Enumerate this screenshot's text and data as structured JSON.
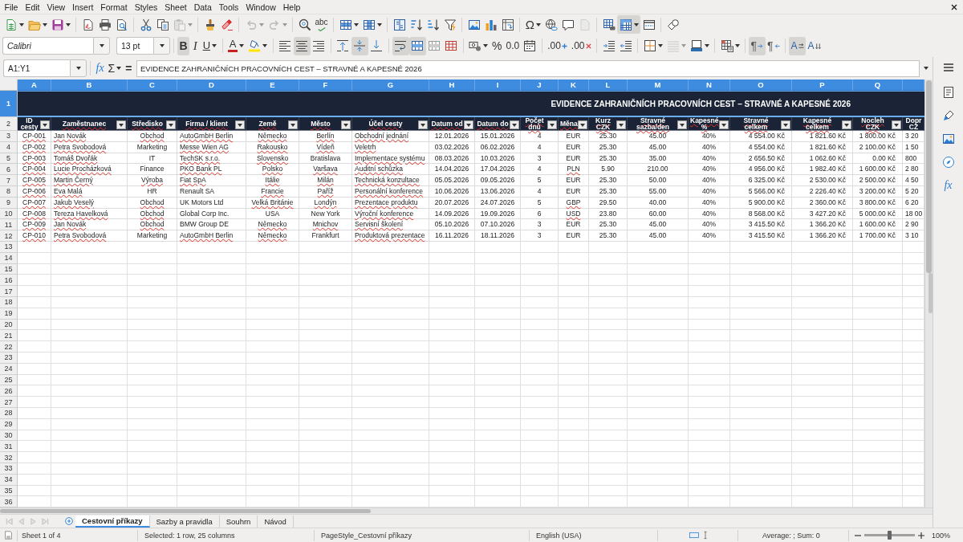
{
  "menu_bar": {
    "items": [
      "File",
      "Edit",
      "View",
      "Insert",
      "Format",
      "Styles",
      "Sheet",
      "Data",
      "Tools",
      "Window",
      "Help"
    ]
  },
  "toolbars": [
    {
      "groups": [
        [
          {
            "kind": "new",
            "dropdown": true,
            "pressed": false,
            "disabled": false
          },
          {
            "kind": "open",
            "dropdown": true,
            "pressed": false,
            "disabled": false
          },
          {
            "kind": "save",
            "dropdown": true,
            "pressed": false,
            "disabled": false
          }
        ],
        [
          {
            "kind": "pdf",
            "pressed": false,
            "disabled": false
          },
          {
            "kind": "print",
            "pressed": false,
            "disabled": false
          },
          {
            "kind": "preview",
            "pressed": false,
            "disabled": false
          }
        ],
        [
          {
            "kind": "cut",
            "pressed": false,
            "disabled": false
          },
          {
            "kind": "copy",
            "pressed": false,
            "disabled": false
          },
          {
            "kind": "paste",
            "dropdown": true,
            "pressed": false,
            "disabled": true
          }
        ],
        [
          {
            "kind": "clone",
            "pressed": false,
            "disabled": false
          },
          {
            "kind": "clear",
            "pressed": false,
            "disabled": false
          }
        ],
        [
          {
            "kind": "undo",
            "dropdown": true,
            "pressed": false,
            "disabled": true
          },
          {
            "kind": "redo",
            "dropdown": true,
            "pressed": false,
            "disabled": true
          }
        ],
        [
          {
            "kind": "find",
            "pressed": false,
            "disabled": false
          },
          {
            "kind": "spelling",
            "label": "abc",
            "pressed": false,
            "disabled": false
          }
        ],
        [
          {
            "kind": "rows",
            "dropdown": true,
            "pressed": false,
            "disabled": false
          },
          {
            "kind": "columns",
            "dropdown": true,
            "pressed": false,
            "disabled": false
          }
        ],
        [
          {
            "kind": "sort",
            "pressed": false,
            "disabled": false
          },
          {
            "kind": "ascending",
            "pressed": false,
            "disabled": false
          },
          {
            "kind": "descending",
            "pressed": false,
            "disabled": false
          },
          {
            "kind": "filter",
            "pressed": false,
            "disabled": false
          }
        ],
        [
          {
            "kind": "image",
            "pressed": false,
            "disabled": false
          },
          {
            "kind": "chart",
            "pressed": false,
            "disabled": false
          },
          {
            "kind": "pivot",
            "pressed": false,
            "disabled": false
          }
        ],
        [
          {
            "kind": "symbol",
            "label": "Ω",
            "dropdown": true,
            "pressed": false,
            "disabled": false
          },
          {
            "kind": "hyperlink",
            "pressed": false,
            "disabled": false
          },
          {
            "kind": "comment",
            "pressed": false,
            "disabled": false
          },
          {
            "kind": "headerfooter",
            "pressed": false,
            "disabled": true
          }
        ],
        [
          {
            "kind": "printarea",
            "pressed": false,
            "disabled": false
          },
          {
            "kind": "freeze",
            "dropdown": true,
            "pressed": true,
            "disabled": false
          },
          {
            "kind": "split",
            "pressed": false,
            "disabled": false
          }
        ],
        [
          {
            "kind": "shapes",
            "pressed": false,
            "disabled": false
          }
        ]
      ]
    },
    {
      "font_name": {
        "value": "Calibri"
      },
      "font_size": {
        "value": "13 pt"
      },
      "groups": [
        [
          {
            "kind": "bold",
            "label": "B",
            "pressed": true,
            "disabled": false
          },
          {
            "kind": "italic",
            "label": "I",
            "pressed": false,
            "disabled": false
          },
          {
            "kind": "underline",
            "label": "U",
            "dropdown": true,
            "pressed": false,
            "disabled": false
          }
        ],
        [
          {
            "kind": "fontcolor",
            "label": "A",
            "dropdown": true,
            "pressed": false,
            "disabled": false
          },
          {
            "kind": "highlight",
            "dropdown": true,
            "pressed": false,
            "disabled": false
          }
        ],
        [
          {
            "kind": "left",
            "pressed": false,
            "disabled": false
          },
          {
            "kind": "center",
            "pressed": true,
            "disabled": false
          },
          {
            "kind": "right",
            "pressed": false,
            "disabled": false
          }
        ],
        [
          {
            "kind": "top",
            "pressed": false,
            "disabled": false
          },
          {
            "kind": "middle",
            "pressed": true,
            "disabled": false
          },
          {
            "kind": "bottom",
            "pressed": false,
            "disabled": false
          }
        ],
        [
          {
            "kind": "wrap",
            "pressed": true,
            "disabled": false
          },
          {
            "kind": "mergecenter",
            "pressed": true,
            "disabled": false
          },
          {
            "kind": "merge",
            "pressed": false,
            "disabled": false
          },
          {
            "kind": "unmerge",
            "pressed": false,
            "disabled": false
          }
        ],
        [
          {
            "kind": "currency",
            "dropdown": true,
            "pressed": false,
            "disabled": false
          },
          {
            "kind": "percent",
            "label": "%",
            "pressed": false,
            "disabled": false
          },
          {
            "kind": "number",
            "label": "0.0",
            "pressed": false,
            "disabled": false
          },
          {
            "kind": "date",
            "pressed": false,
            "disabled": false
          }
        ],
        [
          {
            "kind": "adddecimal",
            "label": ".00",
            "pressed": false,
            "disabled": false
          },
          {
            "kind": "deldecimal",
            "label": ".00",
            "pressed": false,
            "disabled": false
          }
        ],
        [
          {
            "kind": "indent",
            "pressed": false,
            "disabled": false
          },
          {
            "kind": "outdent",
            "pressed": false,
            "disabled": false
          }
        ],
        [
          {
            "kind": "borders",
            "dropdown": true,
            "pressed": false,
            "disabled": false
          },
          {
            "kind": "borderstyle",
            "dropdown": true,
            "pressed": false,
            "disabled": true
          },
          {
            "kind": "bordercolor",
            "dropdown": true,
            "pressed": false,
            "disabled": false
          }
        ],
        [
          {
            "kind": "conditional",
            "dropdown": true,
            "pressed": false,
            "disabled": false
          }
        ],
        [
          {
            "kind": "ltr",
            "label": "¶",
            "pressed": true,
            "disabled": false
          },
          {
            "kind": "rtl",
            "label": "¶",
            "pressed": false,
            "disabled": false
          }
        ],
        [
          {
            "kind": "textdirection",
            "label": "A",
            "pressed": true,
            "disabled": false
          },
          {
            "kind": "vertical",
            "label": "A",
            "pressed": false,
            "disabled": false
          }
        ]
      ]
    }
  ],
  "formula_bar": {
    "name_box": {
      "value": "A1:Y1"
    },
    "buttons": [
      {
        "kind": "wizard",
        "label": "fx"
      },
      {
        "kind": "sum",
        "label": "Σ",
        "dropdown": true
      },
      {
        "kind": "formula",
        "label": "="
      }
    ],
    "formula": {
      "value": "EVIDENCE ZAHRANIČNÍCH PRACOVNÍCH CEST – STRAVNÉ A KAPESNÉ 2026"
    }
  },
  "sheet": {
    "columns": [
      {
        "letter": "A",
        "selected": true
      },
      {
        "letter": "B",
        "selected": true
      },
      {
        "letter": "C",
        "selected": true
      },
      {
        "letter": "D",
        "selected": true
      },
      {
        "letter": "E",
        "selected": true
      },
      {
        "letter": "F",
        "selected": true
      },
      {
        "letter": "G",
        "selected": true
      },
      {
        "letter": "H",
        "selected": true
      },
      {
        "letter": "I",
        "selected": true
      },
      {
        "letter": "J",
        "selected": true
      },
      {
        "letter": "K",
        "selected": true
      },
      {
        "letter": "L",
        "selected": true
      },
      {
        "letter": "M",
        "selected": true
      },
      {
        "letter": "N",
        "selected": true
      },
      {
        "letter": "O",
        "selected": true
      },
      {
        "letter": "P",
        "selected": true
      },
      {
        "letter": "Q",
        "selected": true
      },
      {
        "selected": true
      }
    ],
    "title_row": {
      "number": "1",
      "selected": true,
      "title": "EVIDENCE ZAHRANIČNÍCH PRACOVNÍCH CEST – STRAVNÉ A KAPESNÉ 2026"
    },
    "header_row": {
      "number": "2",
      "selected": false,
      "headers": [
        {
          "label": "ID cesty",
          "misspelled": false,
          "filter_button": true
        },
        {
          "label": "Zaměstnanec",
          "misspelled": true,
          "filter_button": true
        },
        {
          "label": "Středisko",
          "misspelled": true,
          "filter_button": true
        },
        {
          "label": "Firma / klient",
          "misspelled": true,
          "filter_button": true
        },
        {
          "label": "Země",
          "misspelled": true,
          "filter_button": true
        },
        {
          "label": "Město",
          "misspelled": true,
          "filter_button": true
        },
        {
          "label": "Účel cesty",
          "misspelled": true,
          "filter_button": true
        },
        {
          "label": "Datum od",
          "misspelled": true,
          "filter_button": true
        },
        {
          "label": "Datum do",
          "misspelled": true,
          "filter_button": true
        },
        {
          "label": "Počet dnů",
          "misspelled": true,
          "filter_button": true
        },
        {
          "label": "Měna",
          "misspelled": true,
          "filter_button": true
        },
        {
          "label": "Kurz CZK",
          "misspelled": true,
          "filter_button": true
        },
        {
          "label": "Stravné sazba/den",
          "misspelled": true,
          "filter_button": true
        },
        {
          "label": "Kapesné %",
          "misspelled": true,
          "filter_button": true
        },
        {
          "label": "Stravné celkem",
          "misspelled": true,
          "filter_button": true
        },
        {
          "label": "Kapesné celkem",
          "misspelled": true,
          "filter_button": true
        },
        {
          "label": "Nocleh CZK",
          "misspelled": true,
          "filter_button": true
        },
        {
          "label": "Dopr CZ",
          "misspelled": false
        }
      ]
    },
    "rows": [
      {
        "number": "3",
        "selected": false,
        "cells": [
          "CP-001",
          "Jan Novák",
          "Obchod",
          "AutoGmbH Berlin",
          "Německo",
          "Berlín",
          "Obchodní jednání",
          "12.01.2026",
          "15.01.2026",
          "4",
          "EUR",
          "25.30",
          "45.00",
          "40%",
          "4 554.00 Kč",
          "1 821.60 Kč",
          "1 800.00 Kč",
          "3 20"
        ],
        "misspelled": [
          true,
          true,
          true,
          true,
          true,
          true,
          true,
          false,
          false,
          false,
          false,
          false,
          false,
          false,
          false,
          false,
          false,
          false
        ]
      },
      {
        "number": "4",
        "selected": false,
        "cells": [
          "CP-002",
          "Petra Svobodová",
          "Marketing",
          "Messe Wien AG",
          "Rakousko",
          "Vídeň",
          "Veletrh",
          "03.02.2026",
          "06.02.2026",
          "4",
          "EUR",
          "25.30",
          "45.00",
          "40%",
          "4 554.00 Kč",
          "1 821.60 Kč",
          "2 100.00 Kč",
          "1 50"
        ],
        "misspelled": [
          true,
          true,
          false,
          true,
          true,
          true,
          true,
          false,
          false,
          false,
          false,
          false,
          false,
          false,
          false,
          false,
          false,
          false
        ]
      },
      {
        "number": "5",
        "selected": false,
        "cells": [
          "CP-003",
          "Tomáš Dvořák",
          "IT",
          "TechSK s.r.o.",
          "Slovensko",
          "Bratislava",
          "Implementace systému",
          "08.03.2026",
          "10.03.2026",
          "3",
          "EUR",
          "25.30",
          "35.00",
          "40%",
          "2 656.50 Kč",
          "1 062.60 Kč",
          "0.00 Kč",
          "800"
        ],
        "misspelled": [
          true,
          true,
          false,
          true,
          true,
          false,
          true,
          false,
          false,
          false,
          false,
          false,
          false,
          false,
          false,
          false,
          false,
          false
        ]
      },
      {
        "number": "6",
        "selected": false,
        "cells": [
          "CP-004",
          "Lucie Procházková",
          "Finance",
          "PKO Bank PL",
          "Polsko",
          "Varšava",
          "Auditní schůzka",
          "14.04.2026",
          "17.04.2026",
          "4",
          "PLN",
          "5.90",
          "210.00",
          "40%",
          "4 956.00 Kč",
          "1 982.40 Kč",
          "1 600.00 Kč",
          "2 80"
        ],
        "misspelled": [
          true,
          true,
          false,
          true,
          true,
          true,
          true,
          false,
          false,
          false,
          true,
          false,
          false,
          false,
          false,
          false,
          false,
          false
        ]
      },
      {
        "number": "7",
        "selected": false,
        "cells": [
          "CP-005",
          "Martin Černý",
          "Výroba",
          "Fiat SpA",
          "Itálie",
          "Milán",
          "Technická konzultace",
          "05.05.2026",
          "09.05.2026",
          "5",
          "EUR",
          "25.30",
          "50.00",
          "40%",
          "6 325.00 Kč",
          "2 530.00 Kč",
          "2 500.00 Kč",
          "4 50"
        ],
        "misspelled": [
          true,
          true,
          true,
          true,
          true,
          true,
          true,
          false,
          false,
          false,
          false,
          false,
          false,
          false,
          false,
          false,
          false,
          false
        ]
      },
      {
        "number": "8",
        "selected": false,
        "cells": [
          "CP-006",
          "Eva Malá",
          "HR",
          "Renault SA",
          "Francie",
          "Paříž",
          "Personální konference",
          "10.06.2026",
          "13.06.2026",
          "4",
          "EUR",
          "25.30",
          "55.00",
          "40%",
          "5 566.00 Kč",
          "2 226.40 Kč",
          "3 200.00 Kč",
          "5 20"
        ],
        "misspelled": [
          true,
          true,
          false,
          false,
          true,
          true,
          true,
          false,
          false,
          false,
          false,
          false,
          false,
          false,
          false,
          false,
          false,
          false
        ]
      },
      {
        "number": "9",
        "selected": false,
        "cells": [
          "CP-007",
          "Jakub Veselý",
          "Obchod",
          "UK Motors Ltd",
          "Velká Británie",
          "Londýn",
          "Prezentace produktu",
          "20.07.2026",
          "24.07.2026",
          "5",
          "GBP",
          "29.50",
          "40.00",
          "40%",
          "5 900.00 Kč",
          "2 360.00 Kč",
          "3 800.00 Kč",
          "6 20"
        ],
        "misspelled": [
          true,
          true,
          true,
          false,
          true,
          true,
          true,
          false,
          false,
          false,
          true,
          false,
          false,
          false,
          false,
          false,
          false,
          false
        ]
      },
      {
        "number": "10",
        "selected": false,
        "cells": [
          "CP-008",
          "Tereza Havelková",
          "Obchod",
          "Global Corp Inc.",
          "USA",
          "New York",
          "Výroční konference",
          "14.09.2026",
          "19.09.2026",
          "6",
          "USD",
          "23.80",
          "60.00",
          "40%",
          "8 568.00 Kč",
          "3 427.20 Kč",
          "5 000.00 Kč",
          "18 00"
        ],
        "misspelled": [
          true,
          true,
          true,
          false,
          false,
          false,
          true,
          false,
          false,
          false,
          true,
          false,
          false,
          false,
          false,
          false,
          false,
          false
        ]
      },
      {
        "number": "11",
        "selected": false,
        "cells": [
          "CP-009",
          "Jan Novák",
          "Obchod",
          "BMW Group DE",
          "Německo",
          "Mnichov",
          "Servisní školení",
          "05.10.2026",
          "07.10.2026",
          "3",
          "EUR",
          "25.30",
          "45.00",
          "40%",
          "3 415.50 Kč",
          "1 366.20 Kč",
          "1 600.00 Kč",
          "2 90"
        ],
        "misspelled": [
          true,
          true,
          true,
          false,
          true,
          true,
          true,
          false,
          false,
          false,
          false,
          false,
          false,
          false,
          false,
          false,
          false,
          false
        ]
      },
      {
        "number": "12",
        "selected": false,
        "cells": [
          "CP-010",
          "Petra Svobodová",
          "Marketing",
          "AutoGmbH Berlin",
          "Německo",
          "Frankfurt",
          "Produktová prezentace",
          "16.11.2026",
          "18.11.2026",
          "3",
          "EUR",
          "25.30",
          "45.00",
          "40%",
          "3 415.50 Kč",
          "1 366.20 Kč",
          "1 700.00 Kč",
          "3 10"
        ],
        "misspelled": [
          true,
          true,
          false,
          true,
          true,
          false,
          true,
          false,
          false,
          false,
          false,
          false,
          false,
          false,
          false,
          false,
          false,
          false
        ]
      },
      {
        "number": "13",
        "selected": false
      },
      {
        "number": "14",
        "selected": false
      },
      {
        "number": "15",
        "selected": false
      },
      {
        "number": "16",
        "selected": false
      },
      {
        "number": "17",
        "selected": false
      },
      {
        "number": "18",
        "selected": false
      },
      {
        "number": "19",
        "selected": false
      },
      {
        "number": "20",
        "selected": false
      },
      {
        "number": "21",
        "selected": false
      },
      {
        "number": "22",
        "selected": false
      },
      {
        "number": "23",
        "selected": false
      },
      {
        "number": "24",
        "selected": false
      },
      {
        "number": "25",
        "selected": false
      },
      {
        "number": "26",
        "selected": false
      },
      {
        "number": "27",
        "selected": false
      },
      {
        "number": "28",
        "selected": false
      },
      {
        "number": "29",
        "selected": false
      },
      {
        "number": "30",
        "selected": false
      },
      {
        "number": "31",
        "selected": false
      },
      {
        "number": "32",
        "selected": false
      },
      {
        "number": "33",
        "selected": false
      },
      {
        "number": "34",
        "selected": false
      },
      {
        "number": "35",
        "selected": false
      },
      {
        "number": "36",
        "selected": false
      }
    ]
  },
  "sheet_tabs": {
    "navigation": [
      {
        "kind": "first",
        "disabled": true
      },
      {
        "kind": "previous",
        "disabled": true
      },
      {
        "kind": "next",
        "disabled": true
      },
      {
        "kind": "last",
        "disabled": true
      }
    ],
    "tabs": [
      {
        "label": "Cestovní příkazy",
        "selected": true
      },
      {
        "label": "Sazby a pravidla",
        "selected": false
      },
      {
        "label": "Souhrn",
        "selected": false
      },
      {
        "label": "Návod",
        "selected": false
      }
    ]
  },
  "sidebar": {
    "buttons": [
      {
        "kind": "menu",
        "selected": false
      },
      {
        "kind": "properties",
        "selected": false
      },
      {
        "kind": "styles",
        "selected": false
      },
      {
        "kind": "gallery",
        "selected": false
      },
      {
        "kind": "navigator",
        "selected": false
      },
      {
        "kind": "functions",
        "label": "fx",
        "selected": false
      }
    ]
  },
  "status_bar": {
    "sheet": "Sheet 1 of 4",
    "selection": "Selected: 1 row, 25 columns",
    "page_style": "PageStyle_Cestovní příkazy",
    "language": "English (USA)",
    "summary": "Average: ; Sum: 0",
    "zoom": {
      "level": 0.5,
      "reading": "100%"
    }
  }
}
